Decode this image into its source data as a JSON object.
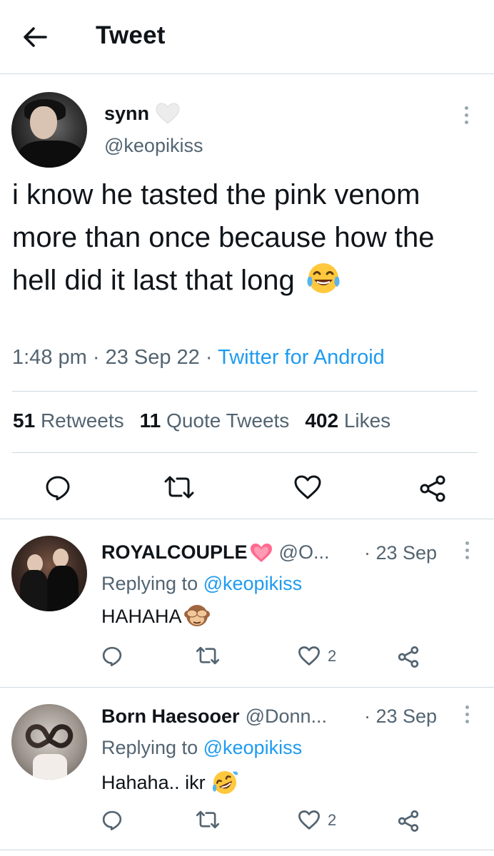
{
  "header": {
    "title": "Tweet",
    "back_icon": "arrow-left-icon"
  },
  "main_tweet": {
    "display_name": "synn",
    "name_badge_icon": "white-heart-icon",
    "handle": "@keopikiss",
    "text": "i know he tasted the pink venom more than once because how the hell did it last that long",
    "emoji_icon": "face-with-tears-of-joy-icon",
    "time": "1:48 pm",
    "date": "23 Sep 22",
    "source": "Twitter for Android",
    "stats": {
      "retweets_count": "51",
      "retweets_label": "Retweets",
      "quotes_count": "11",
      "quotes_label": "Quote Tweets",
      "likes_count": "402",
      "likes_label": "Likes"
    },
    "actions": [
      "reply-icon",
      "retweet-icon",
      "like-icon",
      "share-icon"
    ]
  },
  "replies": [
    {
      "display_name": "ROYALCOUPLE",
      "name_badge_icon": "pink-heart-icon",
      "handle": "@O...",
      "time": "· 23 Sep",
      "replying_prefix": "Replying to",
      "replying_to": "@keopikiss",
      "text": "HAHAHA",
      "emoji_icon": "see-no-evil-monkey-icon",
      "like_count": "2"
    },
    {
      "display_name": "Born Haesooer",
      "handle": "@Donn...",
      "time": "· 23 Sep",
      "replying_prefix": "Replying to",
      "replying_to": "@keopikiss",
      "text": "Hahaha.. ikr",
      "emoji_icon": "rolling-on-floor-laughing-icon",
      "like_count": "2"
    }
  ],
  "colors": {
    "text": "#0f1419",
    "secondary": "#536471",
    "link": "#1d9bf0",
    "divider": "#cfd9de"
  }
}
